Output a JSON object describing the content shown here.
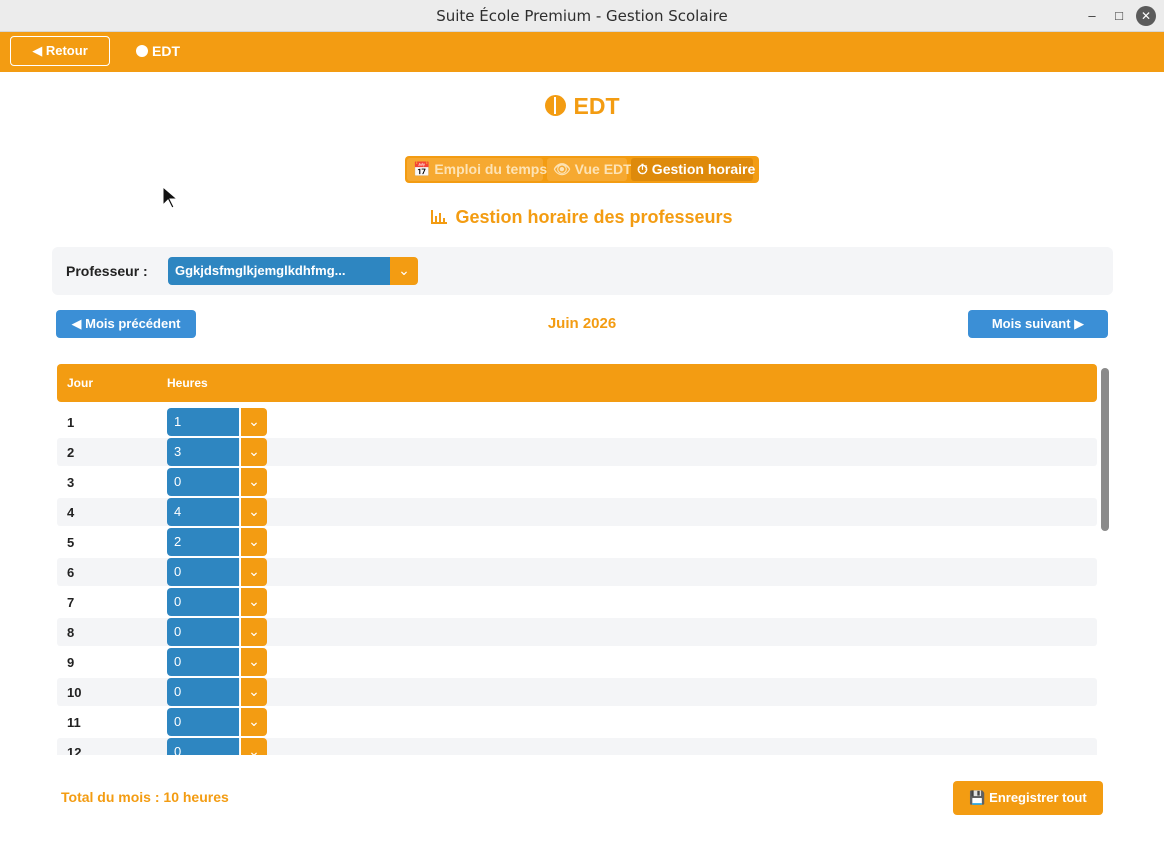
{
  "window": {
    "title": "Suite École Premium - Gestion Scolaire",
    "minimize": "–",
    "maximize": "□",
    "close": "✕"
  },
  "topbar": {
    "back_label": "◀ Retour",
    "crumb": "EDT"
  },
  "page": {
    "title": "EDT"
  },
  "tabs": [
    {
      "label": "📅 Emploi du temps"
    },
    {
      "label": "👁 Vue EDT"
    },
    {
      "label": "⏱ Gestion horaire"
    }
  ],
  "section": {
    "title": "Gestion horaire des professeurs"
  },
  "professeur": {
    "label": "Professeur :",
    "value": "Ggkjdsfmglkjemglkdhfmg...",
    "arrow": "⌄"
  },
  "nav": {
    "prev_label": "◀ Mois précédent",
    "month": "Juin 2026",
    "next_label": "Mois suivant ▶"
  },
  "table": {
    "headers": {
      "day": "Jour",
      "hours": "Heures"
    },
    "rows": [
      {
        "day": "1",
        "hours": "1"
      },
      {
        "day": "2",
        "hours": "3"
      },
      {
        "day": "3",
        "hours": "0"
      },
      {
        "day": "4",
        "hours": "4"
      },
      {
        "day": "5",
        "hours": "2"
      },
      {
        "day": "6",
        "hours": "0"
      },
      {
        "day": "7",
        "hours": "0"
      },
      {
        "day": "8",
        "hours": "0"
      },
      {
        "day": "9",
        "hours": "0"
      },
      {
        "day": "10",
        "hours": "0"
      },
      {
        "day": "11",
        "hours": "0"
      },
      {
        "day": "12",
        "hours": "0"
      }
    ]
  },
  "footer": {
    "total": "Total du mois : 10 heures",
    "save_label": "💾 Enregistrer tout"
  },
  "colors": {
    "accent": "#f39c12",
    "primary_blue": "#2e86c1",
    "nav_blue": "#3b8fd6"
  }
}
